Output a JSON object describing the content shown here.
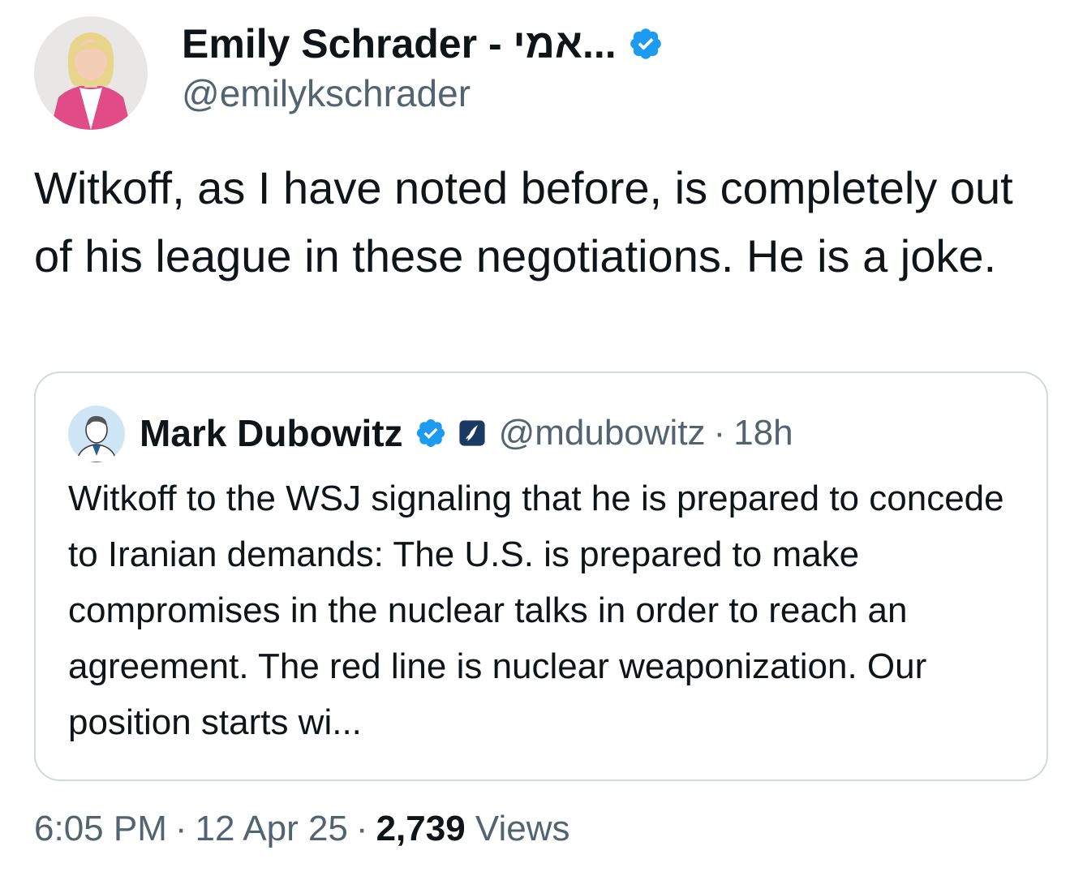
{
  "author": {
    "display_name": "Emily Schrader - אמי...",
    "handle": "@emilykschrader",
    "verified_icon": "verified-badge-icon",
    "avatar_icon": "profile-photo"
  },
  "tweet": {
    "text": "Witkoff, as I have noted before, is completely out of his league in these negotiations. He is a joke."
  },
  "quoted_tweet": {
    "display_name": "Mark Dubowitz",
    "handle": "@mdubowitz",
    "separator": "·",
    "time": "18h",
    "verified_icon": "verified-badge-icon",
    "affiliation_icon": "affiliation-badge-icon",
    "text": "Witkoff to the WSJ signaling that he is prepared to concede to Iranian demands: The U.S. is prepared to make compromises in the nuclear talks in order to reach an agreement. The red line is nuclear weaponization. Our position starts wi..."
  },
  "meta": {
    "time": "6:05 PM",
    "separator": "·",
    "date": "12 Apr 25",
    "views_count": "2,739",
    "views_label": "Views"
  },
  "colors": {
    "text_primary": "#0f1419",
    "text_secondary": "#536471",
    "verified_blue": "#1d9bf0",
    "border": "#cfd9de"
  }
}
